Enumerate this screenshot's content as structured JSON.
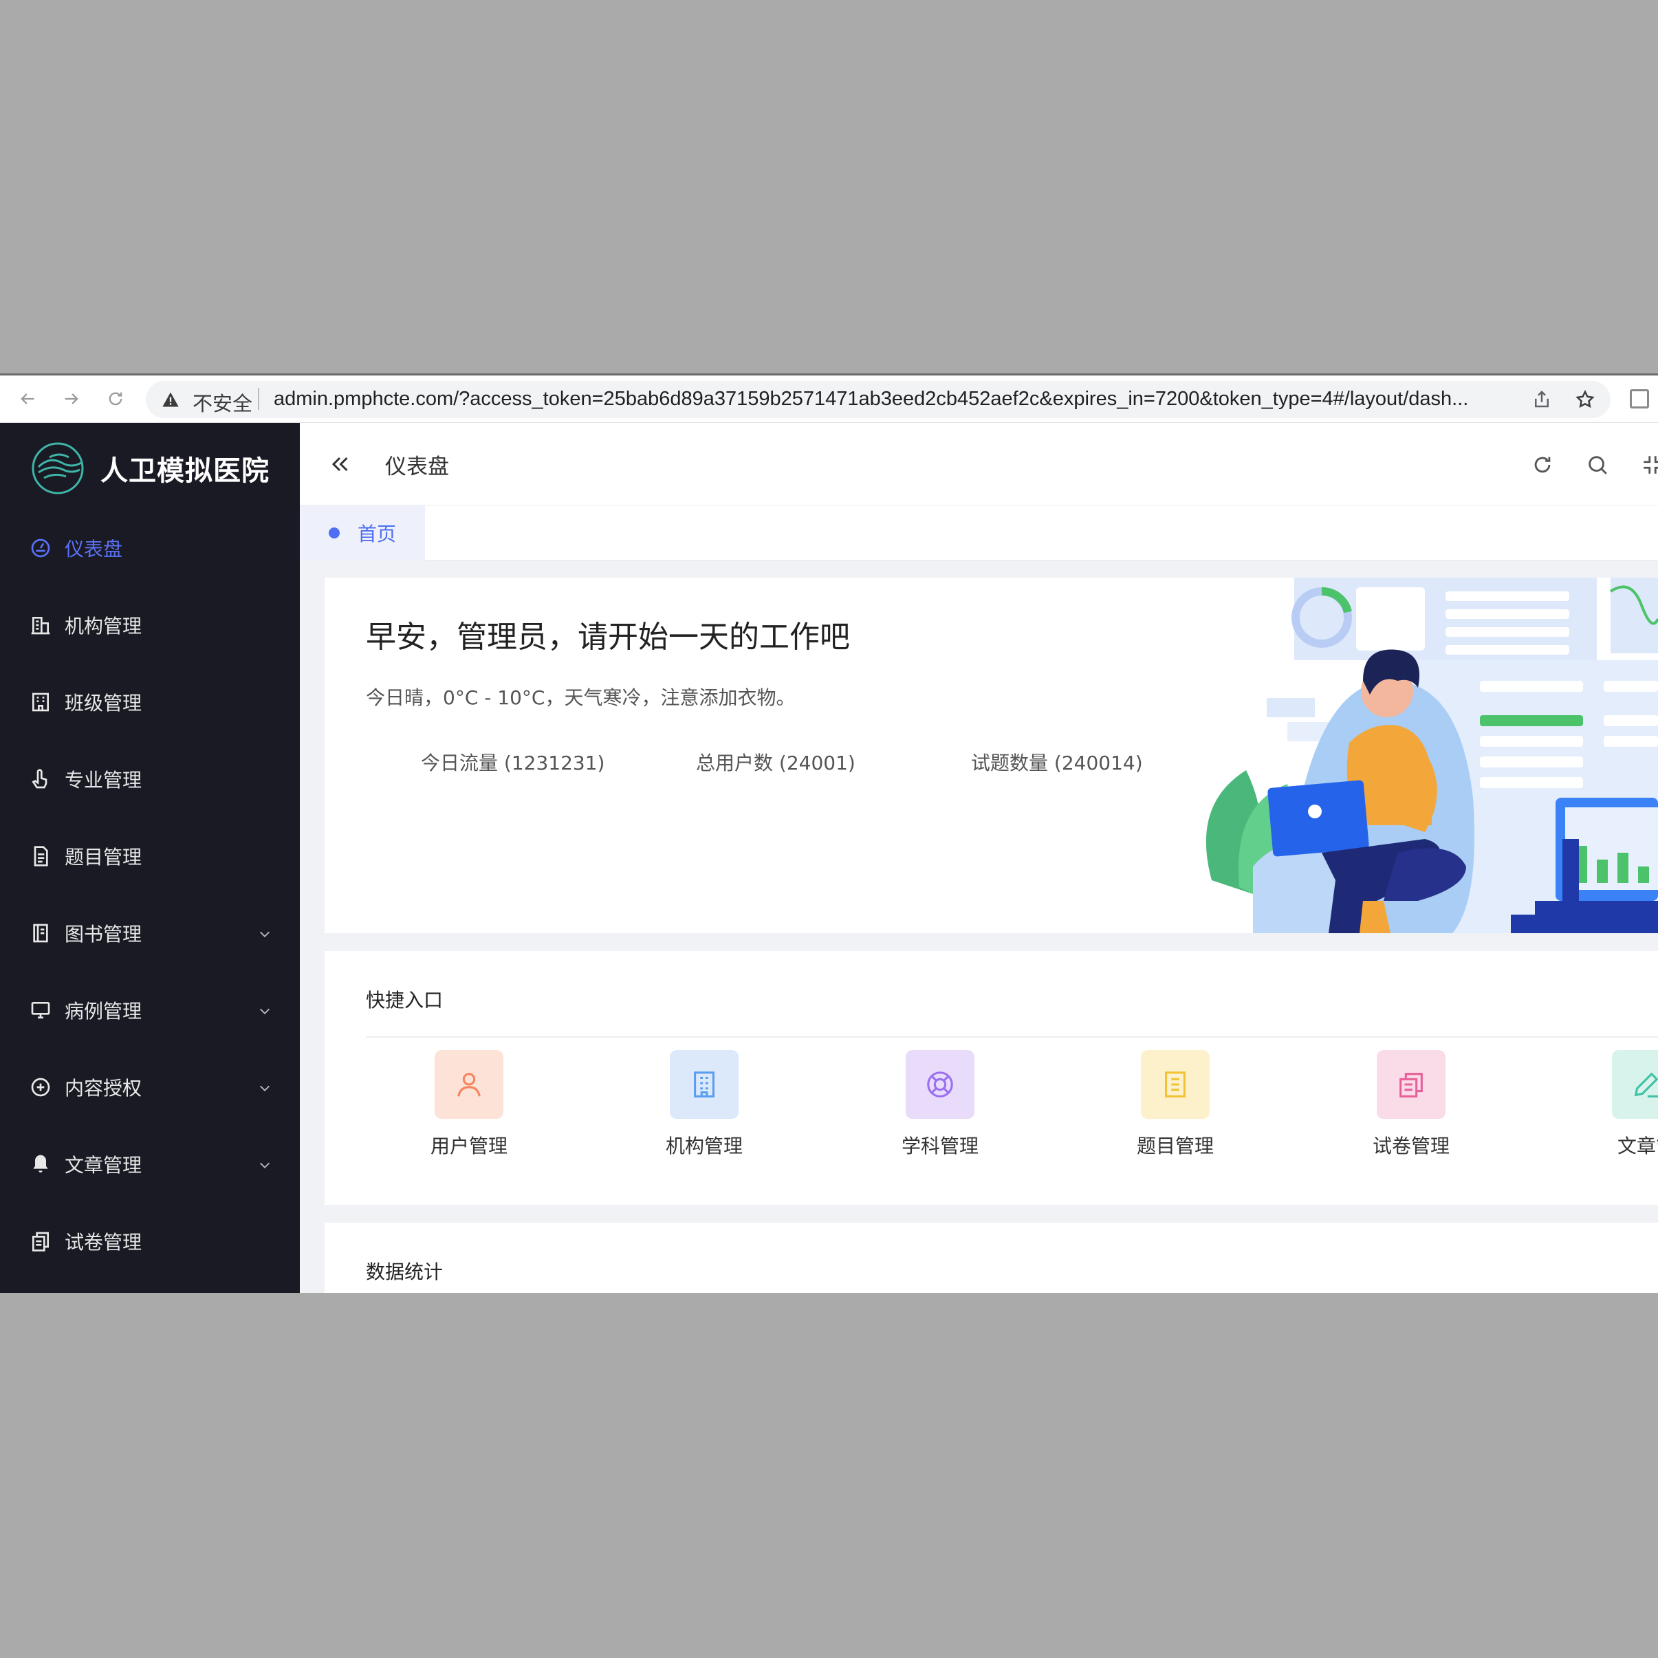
{
  "browser": {
    "insecure_label": "不安全",
    "url": "admin.pmphcte.com/?access_token=25bab6d89a37159b2571471ab3eed2cb452aef2c&expires_in=7200&token_type=4#/layout/dash..."
  },
  "app": {
    "name": "人卫模拟医院"
  },
  "sidebar": {
    "items": [
      {
        "label": "仪表盘",
        "icon": "dashboard-icon",
        "active": true
      },
      {
        "label": "机构管理",
        "icon": "building-icon"
      },
      {
        "label": "班级管理",
        "icon": "office-icon"
      },
      {
        "label": "专业管理",
        "icon": "hand-pointer-icon"
      },
      {
        "label": "题目管理",
        "icon": "document-icon"
      },
      {
        "label": "图书管理",
        "icon": "book-icon",
        "expandable": true
      },
      {
        "label": "病例管理",
        "icon": "monitor-icon",
        "expandable": true
      },
      {
        "label": "内容授权",
        "icon": "plus-circle-icon",
        "expandable": true
      },
      {
        "label": "文章管理",
        "icon": "bell-icon",
        "expandable": true
      },
      {
        "label": "试卷管理",
        "icon": "copy-document-icon"
      }
    ]
  },
  "header": {
    "title": "仪表盘"
  },
  "tabs": [
    {
      "label": "首页",
      "active": true
    }
  ],
  "welcome": {
    "greeting": "早安，管理员，请开始一天的工作吧",
    "weather": "今日晴，0°C - 10°C，天气寒冷，注意添加衣物。",
    "stats": [
      "今日流量 (1231231)",
      "总用户数 (24001)",
      "试题数量 (240014)"
    ]
  },
  "quick_entry": {
    "title": "快捷入口",
    "items": [
      {
        "label": "用户管理",
        "icon": "user-icon",
        "color": "#f7845e",
        "bg": "#fde3d7"
      },
      {
        "label": "机构管理",
        "icon": "building-icon",
        "color": "#5b9ef0",
        "bg": "#dbe9fb"
      },
      {
        "label": "学科管理",
        "icon": "lifebuoy-icon",
        "color": "#9b6ff0",
        "bg": "#e8dcfa"
      },
      {
        "label": "题目管理",
        "icon": "document-icon",
        "color": "#f1c232",
        "bg": "#fdf1cc"
      },
      {
        "label": "试卷管理",
        "icon": "copy-document-icon",
        "color": "#e8609a",
        "bg": "#fadbe8"
      },
      {
        "label": "文章管",
        "icon": "pencil-icon",
        "color": "#3fc1a5",
        "bg": "#d7f3ec"
      }
    ]
  },
  "data_stats": {
    "title": "数据统计"
  },
  "colors": {
    "sidebar_bg": "#191a23",
    "accent": "#4f6ef2"
  }
}
